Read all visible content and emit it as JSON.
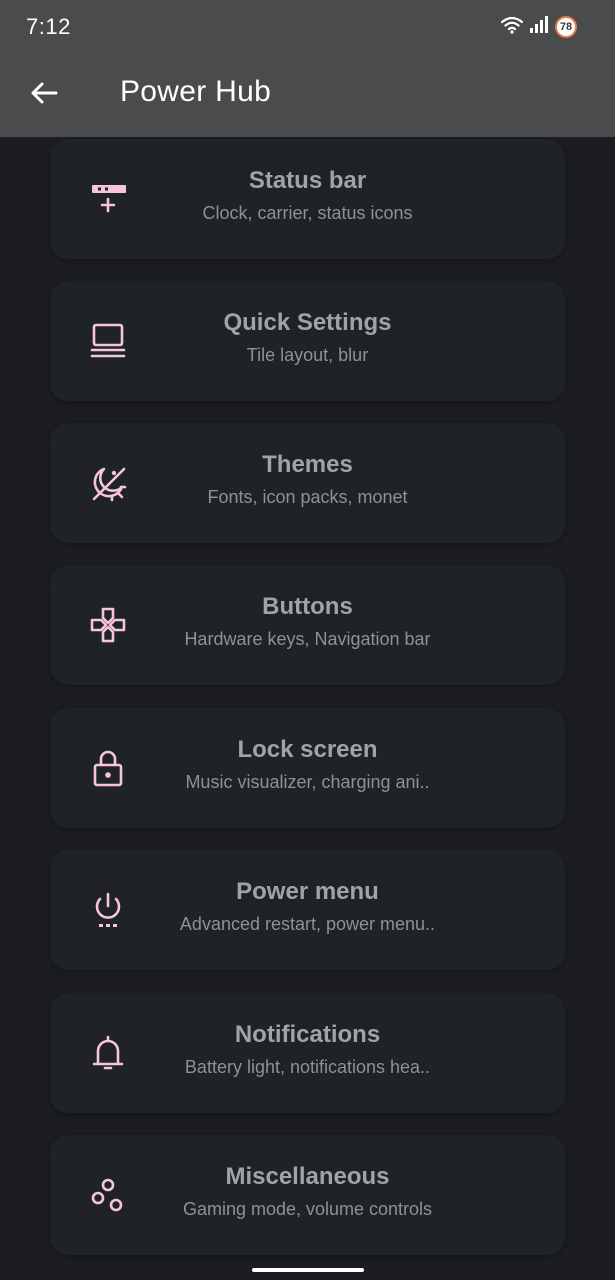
{
  "status_bar": {
    "time": "7:12",
    "battery_level": "78",
    "icons": [
      "wifi-icon",
      "signal-icon",
      "battery-icon"
    ]
  },
  "app_bar": {
    "title": "Power Hub",
    "back_icon": "arrow-left-icon"
  },
  "accent_color": "#f7c6d6",
  "items": [
    {
      "title": "Status bar",
      "subtitle": "Clock, carrier, status icons",
      "icon": "status-bar-icon"
    },
    {
      "title": "Quick Settings",
      "subtitle": "Tile layout, blur",
      "icon": "quick-settings-icon"
    },
    {
      "title": "Themes",
      "subtitle": "Fonts, icon packs, monet",
      "icon": "theme-icon"
    },
    {
      "title": "Buttons",
      "subtitle": "Hardware keys, Navigation bar",
      "icon": "gamepad-icon"
    },
    {
      "title": "Lock screen",
      "subtitle": "Music visualizer, charging ani..",
      "icon": "lock-icon"
    },
    {
      "title": "Power menu",
      "subtitle": "Advanced restart, power menu..",
      "icon": "power-icon"
    },
    {
      "title": "Notifications",
      "subtitle": "Battery light, notifications hea..",
      "icon": "bell-icon"
    },
    {
      "title": "Miscellaneous",
      "subtitle": "Gaming mode, volume controls",
      "icon": "bubbles-icon"
    }
  ]
}
